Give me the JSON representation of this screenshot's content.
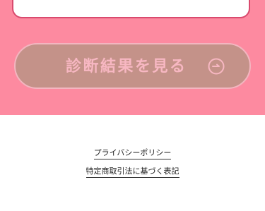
{
  "colors": {
    "pink_background": "#fd8aa0",
    "card_border": "#d94a6e",
    "button_fill": "#c49289",
    "button_border": "#f3b6c0",
    "button_text": "#f7b7c2",
    "footer_text": "#222222"
  },
  "cta": {
    "label": "診断結果を見る",
    "icon": "circle-arrow-right-icon"
  },
  "footer": {
    "links": [
      {
        "label": "プライバシーポリシー"
      },
      {
        "label": "特定商取引法に基づく表記"
      }
    ]
  }
}
